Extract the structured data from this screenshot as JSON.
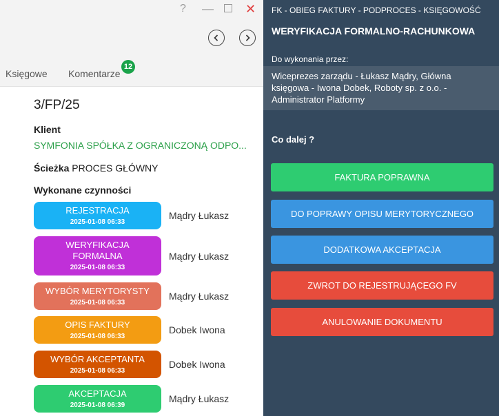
{
  "window": {
    "help": "?",
    "minimize": "—",
    "close": "✕"
  },
  "tabs": [
    {
      "label": "Księgowe"
    },
    {
      "label": "Komentarze",
      "badge": "12"
    }
  ],
  "document": {
    "number": "3/FP/25",
    "client_label": "Klient",
    "client_name": "SYMFONIA SPÓŁKA Z OGRANICZONĄ ODPO...",
    "path_label": "Ścieżka",
    "path_value": " PROCES GŁÓWNY",
    "actions_label": "Wykonane czynności"
  },
  "steps": [
    {
      "name": "REJESTRACJA",
      "date": "2025-01-08 06:33",
      "person": "Mądry Łukasz",
      "color": "#1ab2f5"
    },
    {
      "name": "WERYFIKACJA FORMALNA",
      "date": "2025-01-08 06:33",
      "person": "Mądry Łukasz",
      "color": "#c030d8"
    },
    {
      "name": "WYBÓR MERYTORYSTY",
      "date": "2025-01-08 06:33",
      "person": "Mądry Łukasz",
      "color": "#e2725b"
    },
    {
      "name": "OPIS FAKTURY",
      "date": "2025-01-08 06:33",
      "person": "Dobek Iwona",
      "color": "#f39c12"
    },
    {
      "name": "WYBÓR AKCEPTANTA",
      "date": "2025-01-08 06:33",
      "person": "Dobek Iwona",
      "color": "#d35400"
    },
    {
      "name": "AKCEPTACJA",
      "date": "2025-01-08 06:39",
      "person": "Mądry Łukasz",
      "color": "#2ecc71"
    }
  ],
  "task": {
    "process_path": "FK - OBIEG FAKTURY - PODPROCES - KSIĘGOWOŚĆ",
    "title": "WERYFIKACJA FORMALNO-RACHUNKOWA",
    "assignee_label": "Do wykonania przez:",
    "assignees": "Wiceprezes zarządu - Łukasz Mądry, Główna księgowa - Iwona Dobek, Roboty sp. z o.o. - Administrator Platformy",
    "next_label": "Co dalej ?"
  },
  "actions": [
    {
      "label": "FAKTURA POPRAWNA",
      "color": "#2ecc71"
    },
    {
      "label": "DO POPRAWY OPISU MERYTORYCZNEGO",
      "color": "#3a95e0"
    },
    {
      "label": "DODATKOWA AKCEPTACJA",
      "color": "#3a95e0"
    },
    {
      "label": "ZWROT DO REJESTRUJĄCEGO FV",
      "color": "#e74c3c"
    },
    {
      "label": "ANULOWANIE DOKUMENTU",
      "color": "#e74c3c"
    }
  ]
}
